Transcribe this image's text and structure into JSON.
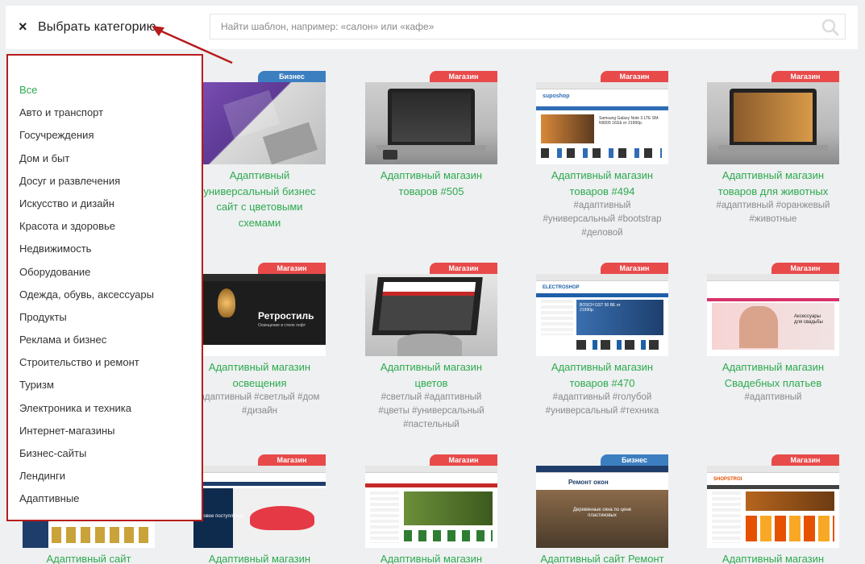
{
  "header": {
    "close_icon": "×",
    "title": "Выбрать категорию",
    "search_placeholder": "Найти шаблон, например: «салон» или «кафе»"
  },
  "colors": {
    "accent_green": "#2eaa4e",
    "badge_shop": "#e84a4a",
    "badge_business": "#3c7fc0",
    "panel_border": "#b71c1c"
  },
  "categories": [
    "Все",
    "Авто и транспорт",
    "Госучреждения",
    "Дом и быт",
    "Досуг и развлечения",
    "Искусство и дизайн",
    "Красота и здоровье",
    "Недвижимость",
    "Оборудование",
    "Одежда, обувь, аксессуары",
    "Продукты",
    "Реклама и бизнес",
    "Строительство и ремонт",
    "Туризм",
    "Электроника и техника",
    "Интернет-магазины",
    "Бизнес-сайты",
    "Лендинги",
    "Адаптивные"
  ],
  "cards": [
    {
      "badge": "Бизнес",
      "title1": "Адаптивный",
      "title2": "универсальный бизнес",
      "title3": "сайт с цветовыми",
      "title4": "схемами",
      "tags1": "",
      "tags2": "",
      "tags3": ""
    },
    {
      "badge": "Магазин",
      "title1": "Адаптивный магазин",
      "title2": "товаров #505",
      "title3": "",
      "title4": "",
      "tags1": "",
      "tags2": "",
      "tags3": ""
    },
    {
      "badge": "Магазин",
      "title1": "Адаптивный магазин",
      "title2": "товаров #494",
      "title3": "",
      "title4": "",
      "tags1": "#адаптивный",
      "tags2": "#универсальный #bootstrap",
      "tags3": "#деловой"
    },
    {
      "badge": "Магазин",
      "title1": "Адаптивный магазин",
      "title2": "товаров для животных",
      "title3": "",
      "title4": "",
      "tags1": "#адаптивный #оранжевый",
      "tags2": "#животные",
      "tags3": ""
    },
    {
      "badge": "Магазин",
      "title1": "Адаптивный магазин",
      "title2": "освещения",
      "title3": "",
      "title4": "",
      "tags1": "адаптивный #светлый #дом",
      "tags2": "#дизайн",
      "tags3": ""
    },
    {
      "badge": "Магазин",
      "title1": "Адаптивный магазин",
      "title2": "цветов",
      "title3": "",
      "title4": "",
      "tags1": "#светлый #адаптивный",
      "tags2": "#цветы #универсальный",
      "tags3": "#пастельный"
    },
    {
      "badge": "Магазин",
      "title1": "Адаптивный магазин",
      "title2": "товаров #470",
      "title3": "",
      "title4": "",
      "tags1": "#адаптивный #голубой",
      "tags2": "#универсальный #техника",
      "tags3": ""
    },
    {
      "badge": "Магазин",
      "title1": "Адаптивный магазин",
      "title2": "Свадебных платьев",
      "title3": "",
      "title4": "",
      "tags1": "#адаптивный",
      "tags2": "",
      "tags3": ""
    },
    {
      "badge": "",
      "title1": "Адаптивный сайт",
      "title2": "",
      "title3": "",
      "title4": "",
      "tags1": "",
      "tags2": "",
      "tags3": ""
    },
    {
      "badge": "Магазин",
      "title1": "Адаптивный магазин",
      "title2": "",
      "title3": "",
      "title4": "",
      "tags1": "",
      "tags2": "",
      "tags3": ""
    },
    {
      "badge": "Магазин",
      "title1": "Адаптивный магазин",
      "title2": "",
      "title3": "",
      "title4": "",
      "tags1": "",
      "tags2": "",
      "tags3": ""
    },
    {
      "badge": "Бизнес",
      "title1": "Адаптивный сайт Ремонт",
      "title2": "",
      "title3": "",
      "title4": "",
      "tags1": "",
      "tags2": "",
      "tags3": ""
    },
    {
      "badge": "Магазин",
      "title1": "Адаптивный магазин",
      "title2": "",
      "title3": "",
      "title4": "",
      "tags1": "",
      "tags2": "",
      "tags3": ""
    }
  ],
  "screenshots": {
    "superstore_brand": "suposhop",
    "phone_promo": "Samsung Galaxy Note 3 LTE SM-N9005 16Gb от 21990р.",
    "retro_title": "Ретростиль",
    "retro_sub": "Освещение в стиле лофт",
    "electro_brand": "ELECTROSHOP",
    "bosch_promo": "BOSCH GST 90 BE от 21990р.",
    "wedding_promo": "Аксессуары для свадьбы",
    "sneakers_promo": "Новое поступление",
    "repair_title": "Ремонт окон",
    "windows_promo": "Деревянные окна по цене пластиковых",
    "shopstroi_brand": "SHOPSTROI"
  }
}
